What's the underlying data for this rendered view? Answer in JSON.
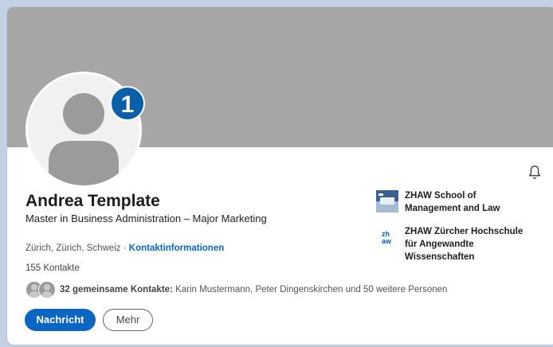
{
  "profile": {
    "step_number": "1",
    "name": "Andrea Template",
    "headline": "Master in Business Administration – Major Marketing",
    "location": "Zürich, Zürich, Schweiz",
    "separator": "·",
    "contact_info_link": "Kontaktinformationen",
    "contacts_count": "155 Kontakte",
    "mutual_contacts_count": "32 gemeinsame Kontakte:",
    "mutual_contacts_names": "Karin Mustermann, Peter Dingenskirchen und 50 weitere Personen"
  },
  "actions": {
    "message_label": "Nachricht",
    "more_label": "Mehr"
  },
  "education": [
    {
      "name_line1": "ZHAW School of",
      "name_line2": "Management and Law",
      "name_line3": ""
    },
    {
      "name_line1": "ZHAW Zürcher Hochschule",
      "name_line2": "für Angewandte",
      "name_line3": "Wissenschaften"
    }
  ],
  "icons": {
    "bell": "bell-icon",
    "avatar": "person-silhouette-icon",
    "zhaw_logo_text": "zh aw"
  },
  "colors": {
    "primary": "#0a66c2",
    "badge": "#0b5ea8",
    "banner": "#a6a6a6",
    "page_bg": "#c3d1e4"
  }
}
